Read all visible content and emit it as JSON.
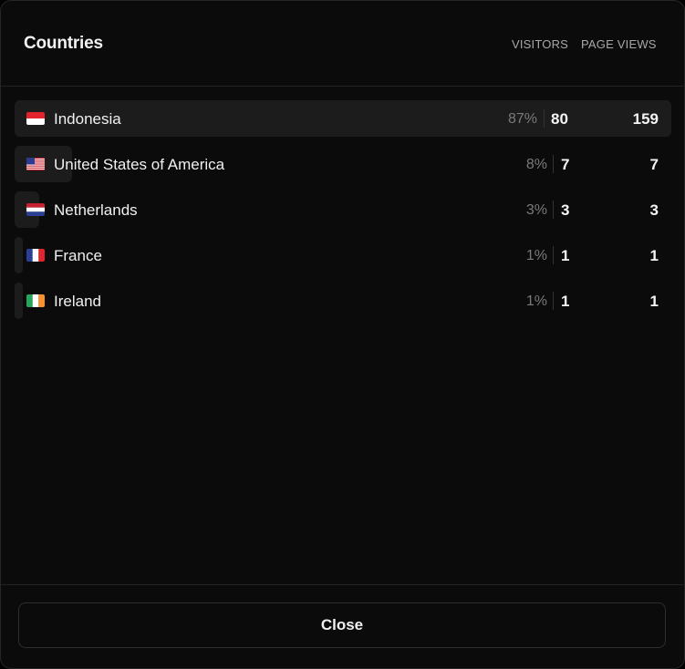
{
  "header": {
    "title": "Countries",
    "visitors_label": "VISITORS",
    "page_views_label": "PAGE VIEWS"
  },
  "rows": [
    {
      "country": "Indonesia",
      "flag": "indonesia-flag-icon",
      "percent": "87%",
      "share": 0.87,
      "visitors": "80",
      "page_views": "159"
    },
    {
      "country": "United States of America",
      "flag": "usa-flag-icon",
      "percent": "8%",
      "share": 0.08,
      "visitors": "7",
      "page_views": "7"
    },
    {
      "country": "Netherlands",
      "flag": "netherlands-flag-icon",
      "percent": "3%",
      "share": 0.03,
      "visitors": "3",
      "page_views": "3"
    },
    {
      "country": "France",
      "flag": "france-flag-icon",
      "percent": "1%",
      "share": 0.01,
      "visitors": "1",
      "page_views": "1"
    },
    {
      "country": "Ireland",
      "flag": "ireland-flag-icon",
      "percent": "1%",
      "share": 0.01,
      "visitors": "1",
      "page_views": "1"
    }
  ],
  "footer": {
    "close_label": "Close"
  },
  "colors": {
    "background": "#0b0b0b",
    "row_bar": "#1c1c1c",
    "text": "#f0f0f0",
    "muted": "#7a7a7a"
  }
}
